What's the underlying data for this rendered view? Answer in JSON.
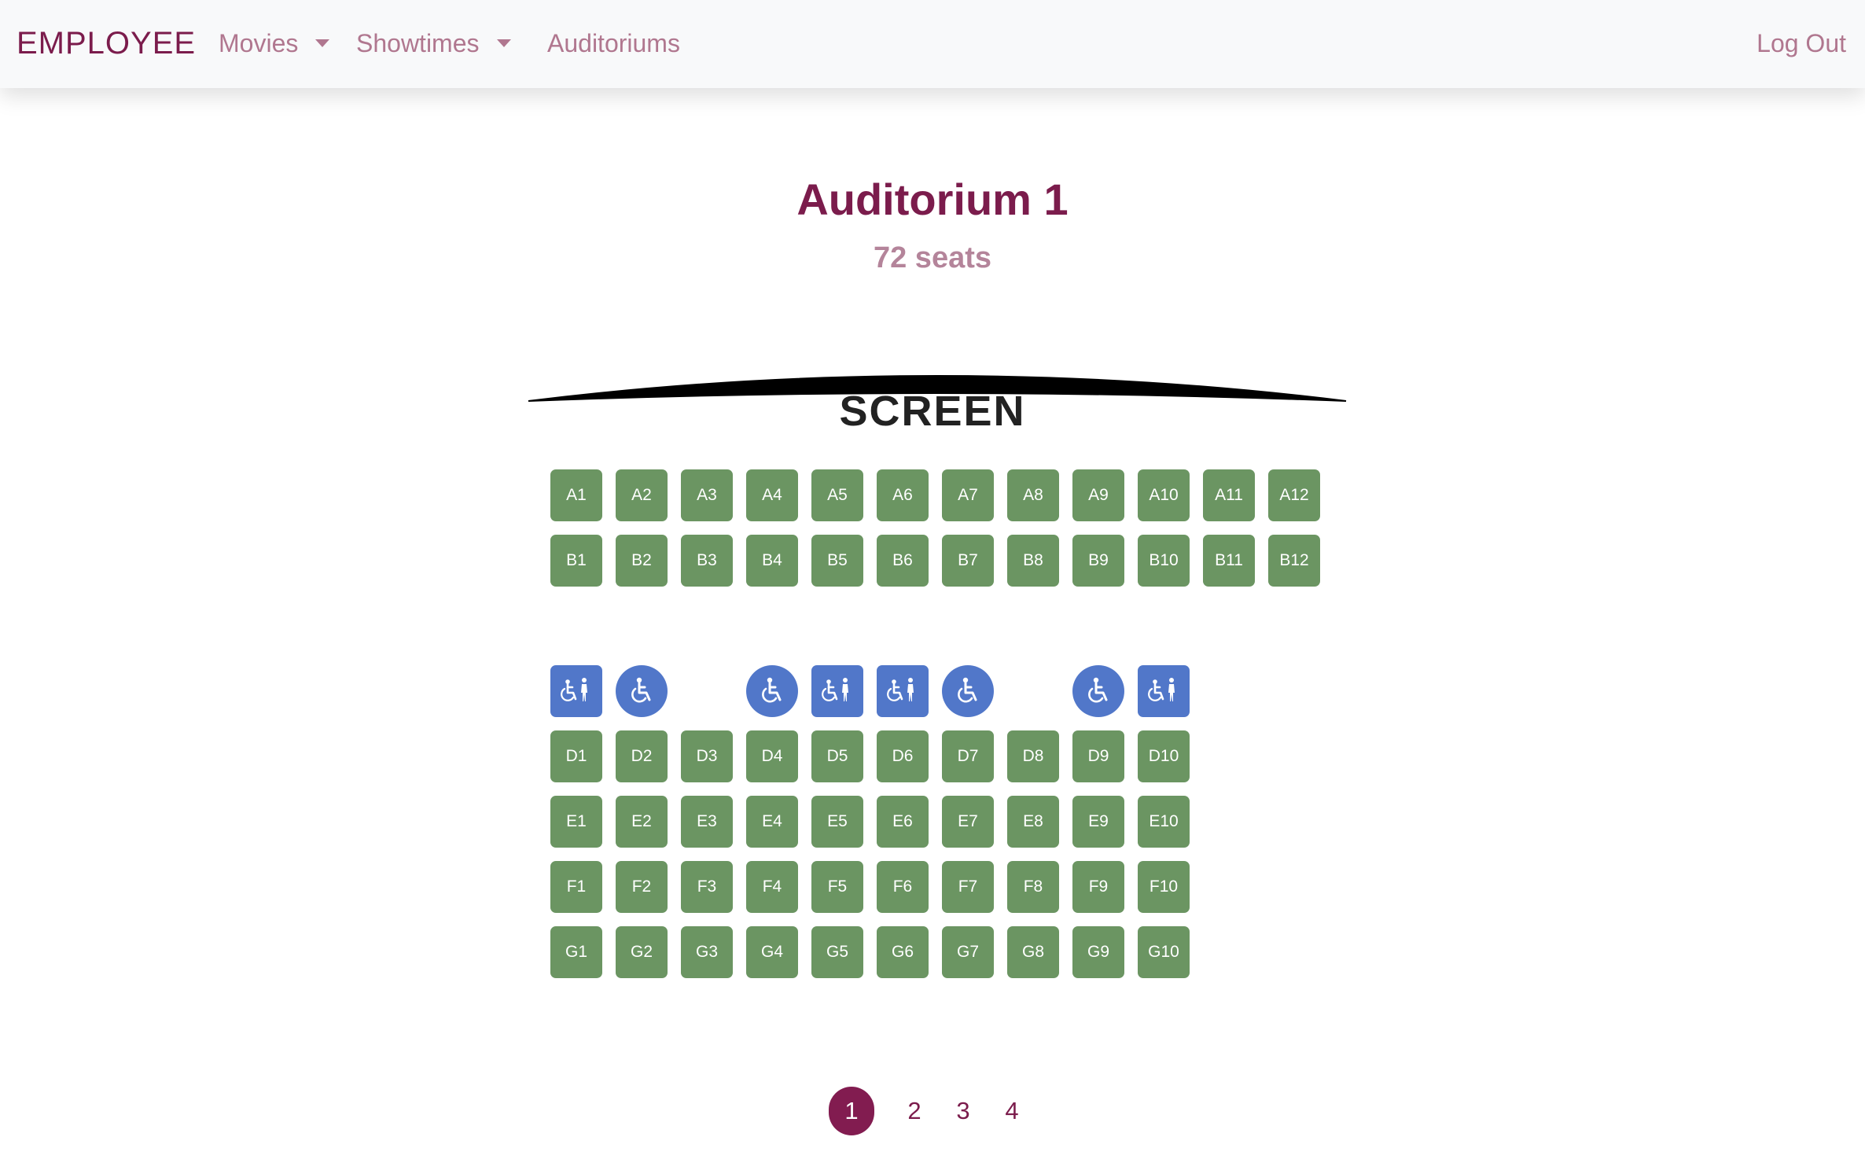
{
  "navbar": {
    "brand": "EMPLOYEE",
    "movies": "Movies",
    "showtimes": "Showtimes",
    "auditoriums": "Auditoriums",
    "logout": "Log Out"
  },
  "auditorium": {
    "title": "Auditorium 1",
    "seat_count": "72 seats"
  },
  "screen_label": "SCREEN",
  "seat_colors": {
    "standard": "#6b9562",
    "accessible": "#5177c9",
    "brand": "#7b1c4c"
  },
  "rows": {
    "A": [
      "A1",
      "A2",
      "A3",
      "A4",
      "A5",
      "A6",
      "A7",
      "A8",
      "A9",
      "A10",
      "A11",
      "A12"
    ],
    "B": [
      "B1",
      "B2",
      "B3",
      "B4",
      "B5",
      "B6",
      "B7",
      "B8",
      "B9",
      "B10",
      "B11",
      "B12"
    ],
    "C": [
      {
        "icon": "wheelchair-companion-icon",
        "shape": "square"
      },
      {
        "icon": "wheelchair-icon",
        "shape": "round"
      },
      null,
      {
        "icon": "wheelchair-icon",
        "shape": "round"
      },
      {
        "icon": "wheelchair-companion-icon",
        "shape": "square"
      },
      {
        "icon": "wheelchair-companion-icon",
        "shape": "square"
      },
      {
        "icon": "wheelchair-icon",
        "shape": "round"
      },
      null,
      {
        "icon": "wheelchair-icon",
        "shape": "round"
      },
      {
        "icon": "wheelchair-companion-icon",
        "shape": "square"
      }
    ],
    "D": [
      "D1",
      "D2",
      "D3",
      "D4",
      "D5",
      "D6",
      "D7",
      "D8",
      "D9",
      "D10"
    ],
    "E": [
      "E1",
      "E2",
      "E3",
      "E4",
      "E5",
      "E6",
      "E7",
      "E8",
      "E9",
      "E10"
    ],
    "F": [
      "F1",
      "F2",
      "F3",
      "F4",
      "F5",
      "F6",
      "F7",
      "F8",
      "F9",
      "F10"
    ],
    "G": [
      "G1",
      "G2",
      "G3",
      "G4",
      "G5",
      "G6",
      "G7",
      "G8",
      "G9",
      "G10"
    ]
  },
  "pagination": {
    "pages": [
      "1",
      "2",
      "3",
      "4"
    ],
    "current": "1"
  }
}
